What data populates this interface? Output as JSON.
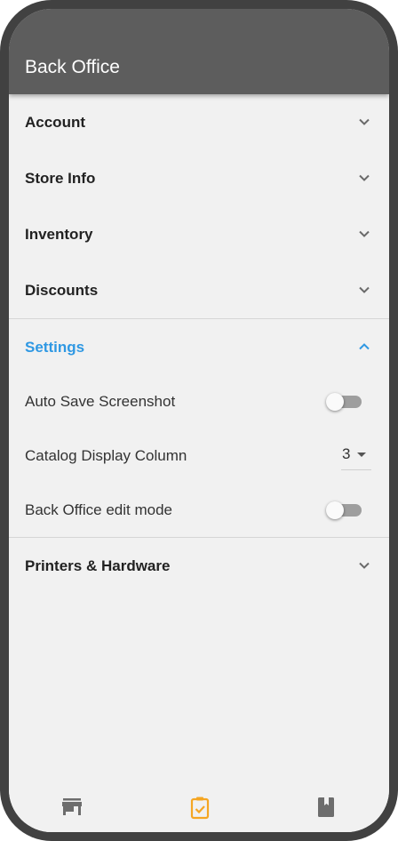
{
  "appbar": {
    "title": "Back Office"
  },
  "sections": [
    {
      "label": "Account"
    },
    {
      "label": "Store Info"
    },
    {
      "label": "Inventory"
    },
    {
      "label": "Discounts"
    },
    {
      "label": "Settings",
      "expanded": true
    },
    {
      "label": "Printers & Hardware"
    }
  ],
  "settings": {
    "auto_save_screenshot": {
      "label": "Auto Save Screenshot",
      "enabled": false
    },
    "catalog_display_column": {
      "label": "Catalog Display Column",
      "value": "3"
    },
    "back_office_edit_mode": {
      "label": "Back Office edit mode",
      "enabled": false
    }
  },
  "bottom_nav": [
    {
      "icon": "store-icon",
      "active": false
    },
    {
      "icon": "clipboard-check-icon",
      "active": true
    },
    {
      "icon": "book-icon",
      "active": false
    }
  ],
  "colors": {
    "appbar": "#5d5d5d",
    "accent": "#2f98e3",
    "active_nav": "#f5a623",
    "inactive_nav": "#6d6d6d",
    "background": "#f1f1f1"
  }
}
